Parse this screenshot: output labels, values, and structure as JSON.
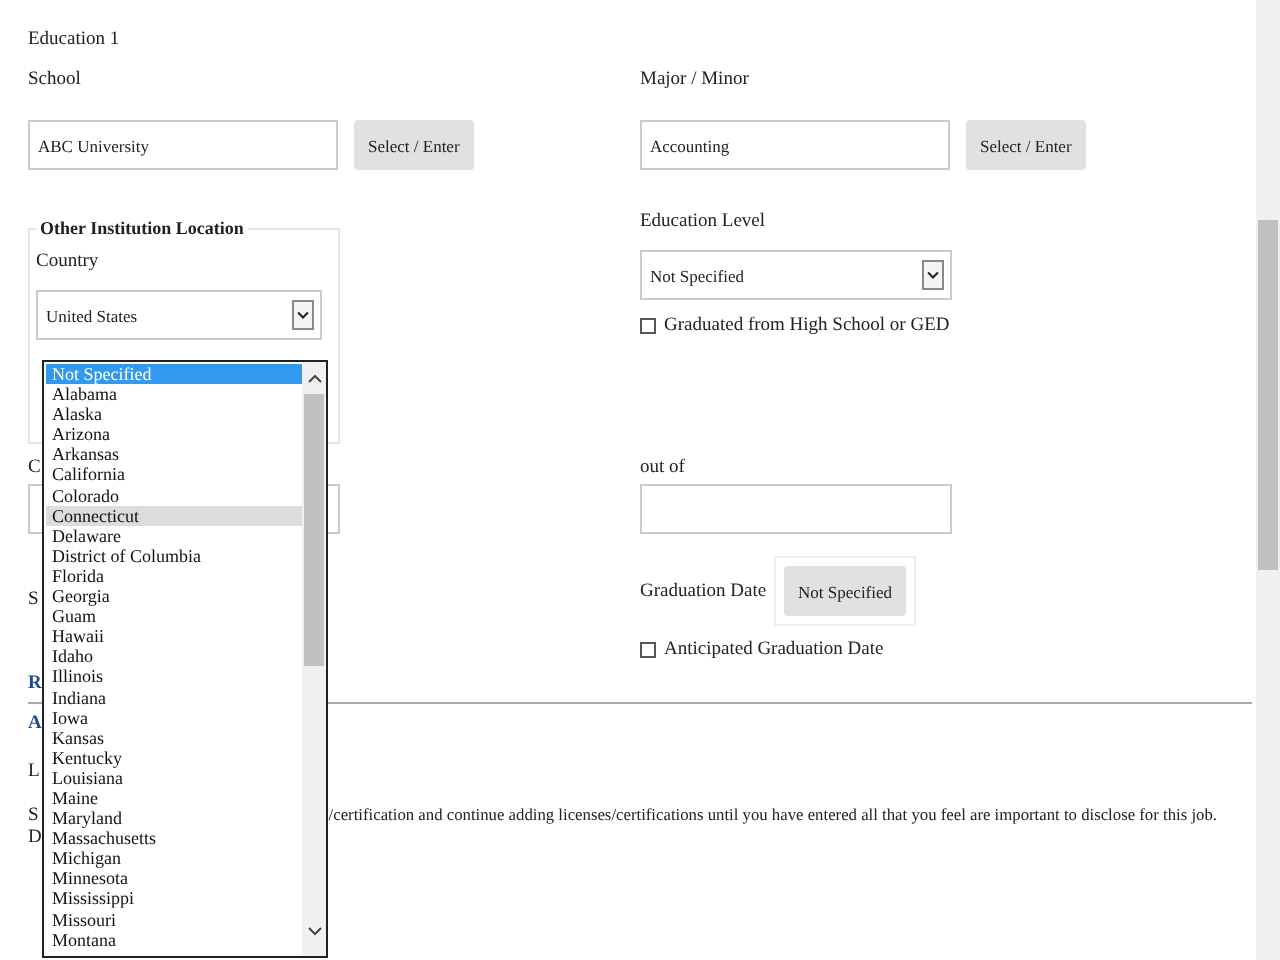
{
  "section_title": "Education 1",
  "school": {
    "label": "School",
    "value": "ABC University",
    "button": "Select / Enter"
  },
  "major": {
    "label": "Major / Minor",
    "value": "Accounting",
    "button": "Select / Enter"
  },
  "location": {
    "legend": "Other Institution Location",
    "country_label": "Country",
    "country_value": "United States"
  },
  "education_level": {
    "label": "Education Level",
    "value": "Not Specified"
  },
  "graduated_hs": {
    "label": "Graduated from High School or GED",
    "checked": false
  },
  "left_label_1": "C",
  "out_of": {
    "label": "out of"
  },
  "left_label_2": "S",
  "graduation_date": {
    "label": "Graduation Date",
    "button": "Not Specified"
  },
  "anticipated": {
    "label": "Anticipated Graduation Date",
    "checked": false
  },
  "lower": {
    "heading": "R",
    "subheading": "A",
    "label": "L",
    "instruction_start": "S",
    "instruction_visible": "/certification and continue adding licenses/certifications until you have entered all that you feel are important to disclose for this job.",
    "line_start": "D"
  },
  "state_dropdown": {
    "options": [
      {
        "label": "Not Specified",
        "selected": true,
        "hovered": false
      },
      {
        "label": "Alabama",
        "selected": false,
        "hovered": false
      },
      {
        "label": "Alaska",
        "selected": false,
        "hovered": false
      },
      {
        "label": "Arizona",
        "selected": false,
        "hovered": false
      },
      {
        "label": "Arkansas",
        "selected": false,
        "hovered": false
      },
      {
        "label": "California",
        "selected": false,
        "hovered": false
      },
      {
        "label": "Colorado",
        "selected": false,
        "hovered": false
      },
      {
        "label": "Connecticut",
        "selected": false,
        "hovered": true
      },
      {
        "label": "Delaware",
        "selected": false,
        "hovered": false
      },
      {
        "label": "District of Columbia",
        "selected": false,
        "hovered": false
      },
      {
        "label": "Florida",
        "selected": false,
        "hovered": false
      },
      {
        "label": "Georgia",
        "selected": false,
        "hovered": false
      },
      {
        "label": "Guam",
        "selected": false,
        "hovered": false
      },
      {
        "label": "Hawaii",
        "selected": false,
        "hovered": false
      },
      {
        "label": "Idaho",
        "selected": false,
        "hovered": false
      },
      {
        "label": "Illinois",
        "selected": false,
        "hovered": false
      },
      {
        "label": "Indiana",
        "selected": false,
        "hovered": false
      },
      {
        "label": "Iowa",
        "selected": false,
        "hovered": false
      },
      {
        "label": "Kansas",
        "selected": false,
        "hovered": false
      },
      {
        "label": "Kentucky",
        "selected": false,
        "hovered": false
      },
      {
        "label": "Louisiana",
        "selected": false,
        "hovered": false
      },
      {
        "label": "Maine",
        "selected": false,
        "hovered": false
      },
      {
        "label": "Maryland",
        "selected": false,
        "hovered": false
      },
      {
        "label": "Massachusetts",
        "selected": false,
        "hovered": false
      },
      {
        "label": "Michigan",
        "selected": false,
        "hovered": false
      },
      {
        "label": "Minnesota",
        "selected": false,
        "hovered": false
      },
      {
        "label": "Mississippi",
        "selected": false,
        "hovered": false
      },
      {
        "label": "Missouri",
        "selected": false,
        "hovered": false
      },
      {
        "label": "Montana",
        "selected": false,
        "hovered": false
      }
    ]
  }
}
